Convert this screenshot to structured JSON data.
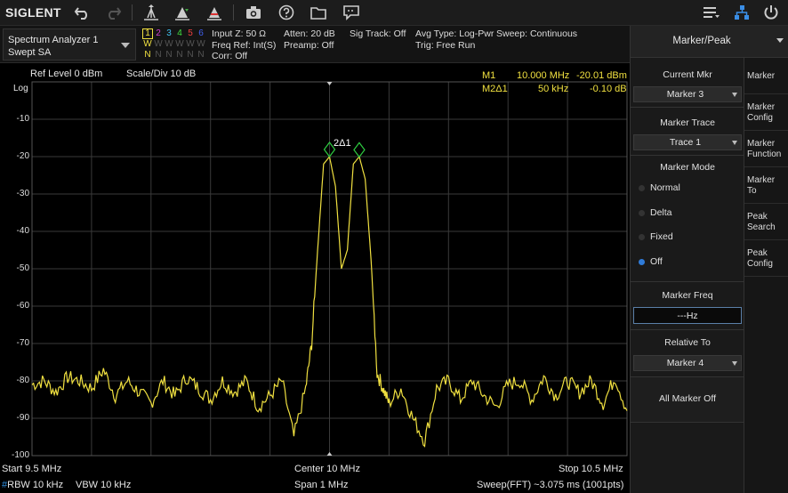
{
  "toolbar": {
    "logo": "SIGLENT",
    "icons": [
      "undo-icon",
      "redo-icon",
      "peak-search-icon",
      "marker-to-center-icon",
      "marker-delta-icon",
      "camera-icon",
      "help-icon",
      "folder-icon",
      "message-icon",
      "menu-list-icon",
      "network-icon",
      "power-icon"
    ]
  },
  "mode": {
    "line1": "Spectrum Analyzer 1",
    "line2": "Swept SA"
  },
  "traces": {
    "numbers": [
      "1",
      "2",
      "3",
      "4",
      "5",
      "6"
    ],
    "number_colors": [
      "#f0e040",
      "#d040d0",
      "#40c0f0",
      "#40e040",
      "#f04040",
      "#4060f0"
    ],
    "modes": [
      "W",
      "W",
      "W",
      "W",
      "W",
      "W"
    ],
    "dets": [
      "N",
      "N",
      "N",
      "N",
      "N",
      "N"
    ]
  },
  "info": {
    "col1": [
      "Input Z: 50 Ω",
      "Freq Ref: Int(S)",
      "Corr: Off"
    ],
    "col2": [
      "Atten: 20 dB",
      "Preamp: Off"
    ],
    "col3": [
      "Sig Track: Off"
    ],
    "col4": [
      "Avg Type: Log-Pwr",
      "Trig: Free Run"
    ],
    "col5": [
      "Sweep: Continuous"
    ]
  },
  "plot": {
    "ref_level": "Ref Level  0 dBm",
    "scale_div": "Scale/Div  10 dB",
    "log_label": "Log",
    "y_ticks": [
      "-10",
      "-20",
      "-30",
      "-40",
      "-50",
      "-60",
      "-70",
      "-80",
      "-90",
      "-100"
    ],
    "markers": [
      {
        "name": "M1",
        "freq": "10.000 MHz",
        "value": "-20.01 dBm"
      },
      {
        "name": "M2Δ1",
        "freq": "50 kHz",
        "value": "-0.10 dB"
      }
    ],
    "marker_label": "2Δ1",
    "start": "Start  9.5 MHz",
    "center": "Center  10 MHz",
    "stop": "Stop  10.5 MHz",
    "rbw_prefix": "#",
    "rbw": "RBW  10 kHz",
    "vbw": "VBW  10 kHz",
    "span": "Span  1 MHz",
    "sweep": "Sweep(FFT)  ~3.075 ms (1001pts)",
    "trace_color": "#f0e040"
  },
  "chart_data": {
    "type": "line",
    "x_range_mhz": [
      9.5,
      10.5
    ],
    "y_range_dbm": [
      -100,
      0
    ],
    "series": [
      {
        "x": [
          9.5,
          9.52,
          9.54,
          9.56,
          9.58,
          9.6,
          9.62,
          9.64,
          9.66,
          9.68,
          9.7,
          9.72,
          9.74,
          9.76,
          9.78,
          9.8,
          9.82,
          9.84,
          9.86,
          9.88,
          9.9,
          9.92,
          9.94,
          9.96,
          9.97,
          9.98,
          9.99,
          10.0,
          10.01,
          10.02,
          10.03,
          10.04,
          10.05,
          10.06,
          10.07,
          10.08,
          10.09,
          10.1,
          10.12,
          10.14,
          10.16,
          10.18,
          10.2,
          10.22,
          10.24,
          10.26,
          10.28,
          10.3,
          10.32,
          10.34,
          10.36,
          10.38,
          10.4,
          10.42,
          10.44,
          10.46,
          10.48,
          10.5
        ],
        "y": [
          -81,
          -80,
          -83,
          -79,
          -80,
          -82,
          -77,
          -84,
          -80,
          -83,
          -86,
          -80,
          -84,
          -79,
          -82,
          -85,
          -80,
          -83,
          -80,
          -87,
          -84,
          -80,
          -95,
          -82,
          -70,
          -45,
          -22,
          -20,
          -28,
          -50,
          -45,
          -22,
          -20,
          -26,
          -48,
          -78,
          -82,
          -86,
          -82,
          -90,
          -96,
          -82,
          -80,
          -85,
          -80,
          -84,
          -87,
          -81,
          -80,
          -85,
          -79,
          -84,
          -80,
          -83,
          -80,
          -86,
          -79,
          -88
        ]
      }
    ]
  },
  "panel": {
    "title": "Marker/Peak",
    "current_mkr_label": "Current Mkr",
    "current_mkr_value": "Marker 3",
    "marker_trace_label": "Marker Trace",
    "marker_trace_value": "Trace 1",
    "marker_mode_label": "Marker Mode",
    "modes": [
      "Normal",
      "Delta",
      "Fixed",
      "Off"
    ],
    "mode_selected": "Off",
    "marker_freq_label": "Marker Freq",
    "marker_freq_value": "---Hz",
    "relative_to_label": "Relative To",
    "relative_to_value": "Marker 4",
    "all_off": "All Marker Off"
  },
  "softmenu": [
    [
      "Marker"
    ],
    [
      "Marker",
      "Config"
    ],
    [
      "Marker",
      "Function"
    ],
    [
      "Marker",
      "To"
    ],
    [
      "Peak",
      "Search"
    ],
    [
      "Peak",
      "Config"
    ]
  ]
}
